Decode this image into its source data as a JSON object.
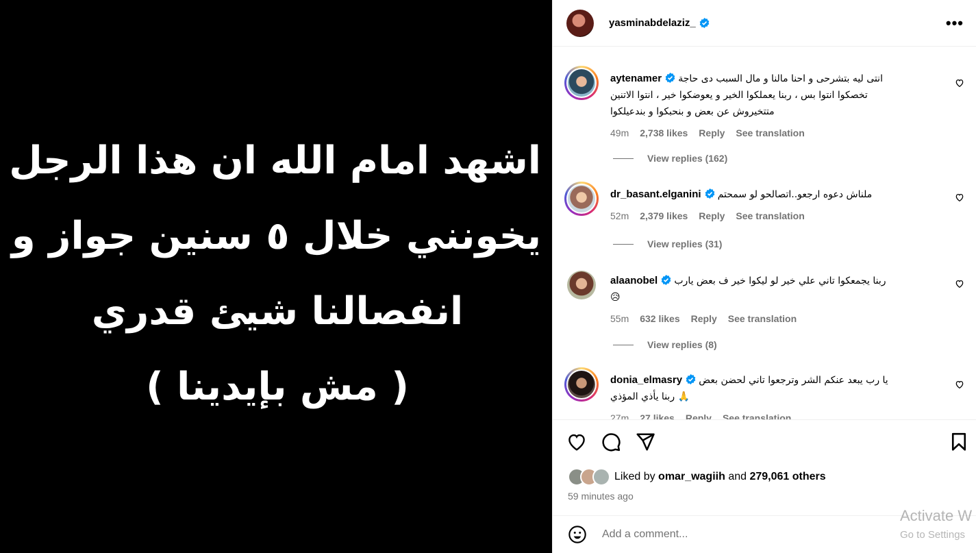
{
  "post": {
    "image_lines": [
      "اشهد امام الله ان هذا الرجل لم",
      "يخونني خلال ٥ سنين جواز و",
      "انفصالنا شيئ قدري",
      "( مش بإيدينا )"
    ]
  },
  "header": {
    "username": "yasminabdelaziz_",
    "more_icon": "more-horizontal-icon"
  },
  "comments": [
    {
      "username": "aytenamer",
      "text_lines": [
        "انتى ليه بتشرحى و احنا مالنا و مال السبب دى حاجة",
        "تخصكوا انتوا بس ، ربنا يعملكوا الخير و يعوضكوا خير ، انتوا الاتنين",
        "متتخيروش عن بعض و بنحبكوا و بندعيلكوا"
      ],
      "time": "49m",
      "likes": "2,738 likes",
      "reply": "Reply",
      "translate": "See translation",
      "replies": "View replies (162)"
    },
    {
      "username": "dr_basant.elganini",
      "text_lines": [
        "ملناش دعوه ارجعو..اتصالحو لو سمحتم"
      ],
      "time": "52m",
      "likes": "2,379 likes",
      "reply": "Reply",
      "translate": "See translation",
      "replies": "View replies (31)"
    },
    {
      "username": "alaanobel",
      "text_lines": [
        "ربنا يجمعكوا تاني علي خير لو ليكوا خير ف بعض يارب",
        "😥"
      ],
      "time": "55m",
      "likes": "632 likes",
      "reply": "Reply",
      "translate": "See translation",
      "replies": "View replies (8)"
    },
    {
      "username": "donia_elmasry",
      "text_lines": [
        "يا رب يبعد عنكم الشر وترجعوا تاني لحضن بعض",
        "ربنا يأذي المؤذي 🙏"
      ],
      "time": "27m",
      "likes": "27 likes",
      "reply": "Reply",
      "translate": "See translation"
    }
  ],
  "actions": {
    "liked_by_prefix": "Liked by",
    "liked_by_user": "omar_wagiih",
    "liked_by_and": "and",
    "liked_by_others": "279,061 others",
    "time": "59 minutes ago"
  },
  "add_comment": {
    "placeholder": "Add a comment..."
  },
  "watermark": {
    "title": "Activate W",
    "subtitle": "Go to Settings"
  },
  "colors": {
    "verified": "#0095f6",
    "muted": "#737373",
    "border": "#efefef"
  }
}
